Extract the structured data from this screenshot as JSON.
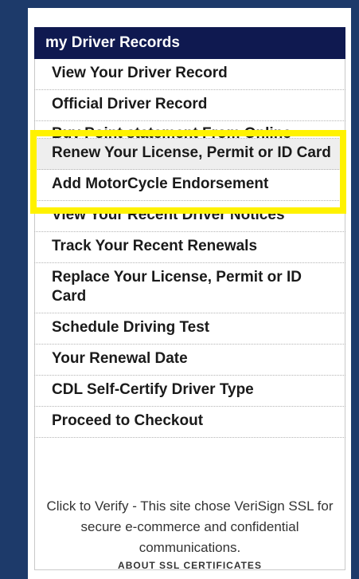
{
  "header": {
    "title": "my Driver Records"
  },
  "menu": {
    "items": [
      {
        "label": "View Your Driver Record"
      },
      {
        "label": "Official Driver Record"
      },
      {
        "label": "Buy Point statement From Online"
      },
      {
        "label": "Renew Your License, Permit or ID Card"
      },
      {
        "label": "Add MotorCycle Endorsement"
      },
      {
        "label": "View Your Recent Driver Notices"
      },
      {
        "label": "Track Your Recent Renewals"
      },
      {
        "label": "Replace Your License, Permit or ID Card"
      },
      {
        "label": "Schedule Driving Test"
      },
      {
        "label": "Your Renewal Date"
      },
      {
        "label": "CDL Self-Certify Driver Type"
      },
      {
        "label": "Proceed to Checkout"
      }
    ]
  },
  "verisign": {
    "text": "Click to Verify - This site chose VeriSign SSL for secure e-commerce and confidential communications.",
    "link": "ABOUT SSL CERTIFICATES"
  },
  "colors": {
    "background": "#1d3a6a",
    "header_bg": "#0f1950",
    "highlight": "#fff200"
  }
}
